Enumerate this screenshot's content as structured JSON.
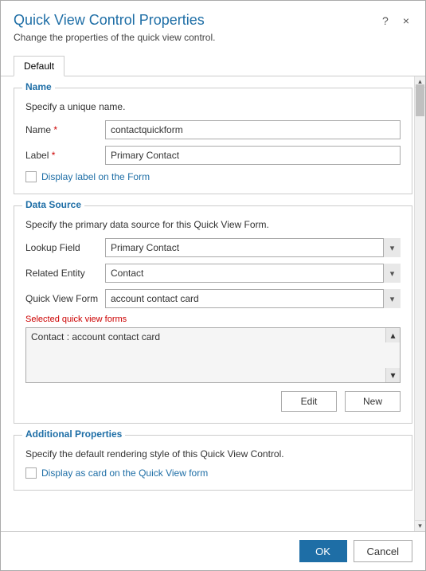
{
  "dialog": {
    "title": "Quick View Control Properties",
    "subtitle": "Change the properties of the quick view control.",
    "help_label": "?",
    "close_label": "×"
  },
  "tabs": [
    {
      "label": "Default",
      "active": true
    }
  ],
  "name_section": {
    "legend": "Name",
    "description": "Specify a unique name.",
    "name_label": "Name",
    "name_required": "*",
    "name_value": "contactquickform",
    "label_label": "Label",
    "label_required": "*",
    "label_value": "Primary Contact",
    "checkbox_label": "Display label on the Form"
  },
  "datasource_section": {
    "legend": "Data Source",
    "description": "Specify the primary data source for this Quick View Form.",
    "lookup_field_label": "Lookup Field",
    "lookup_field_value": "Primary Contact",
    "related_entity_label": "Related Entity",
    "related_entity_value": "Contact",
    "quick_view_form_label": "Quick View Form",
    "quick_view_form_value": "account contact card",
    "selected_forms_label": "Selected quick view forms",
    "selected_forms_item": "Contact : account contact card",
    "edit_button": "Edit",
    "new_button": "New"
  },
  "additional_section": {
    "legend": "Additional Properties",
    "description": "Specify the default rendering style of this Quick View Control.",
    "checkbox_label": "Display as card on the Quick View form"
  },
  "footer": {
    "ok_label": "OK",
    "cancel_label": "Cancel"
  }
}
